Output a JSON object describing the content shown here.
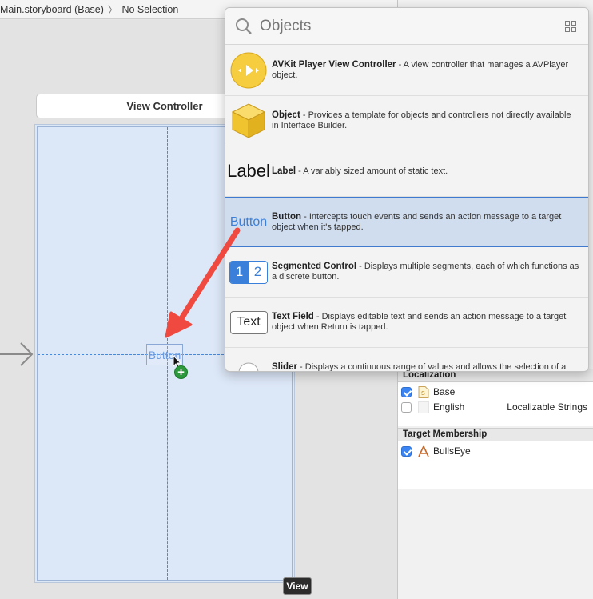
{
  "breadcrumb": {
    "file": "Main.storyboard (Base)",
    "selection": "No Selection"
  },
  "canvas": {
    "scene_title": "View Controller",
    "dragged_element_label": "Button",
    "tooltip": "View"
  },
  "library": {
    "search_placeholder": "Objects",
    "items": [
      {
        "title": "AVKit Player View Controller",
        "desc": " - A view controller that manages a AVPlayer object.",
        "icon": "avkit-player-icon"
      },
      {
        "title": "Object",
        "desc": " - Provides a template for objects and controllers not directly available in Interface Builder.",
        "icon": "object-cube-icon"
      },
      {
        "title": "Label",
        "desc": " - A variably sized amount of static text.",
        "icon": "label-icon",
        "icon_text": "Label"
      },
      {
        "title": "Button",
        "desc": " - Intercepts touch events and sends an action message to a target object when it's tapped.",
        "icon": "button-icon",
        "icon_text": "Button",
        "selected": true
      },
      {
        "title": "Segmented Control",
        "desc": " - Displays multiple segments, each of which functions as a discrete button.",
        "icon": "segmented-control-icon",
        "seg_labels": [
          "1",
          "2"
        ]
      },
      {
        "title": "Text Field",
        "desc": " - Displays editable text and sends an action message to a target object when Return is tapped.",
        "icon": "text-field-icon",
        "icon_text": "Text"
      },
      {
        "title": "Slider",
        "desc": " - Displays a continuous range of values and allows the selection of a single value.",
        "icon": "slider-icon"
      }
    ]
  },
  "inspector": {
    "localization_header": "Localization",
    "localization": [
      {
        "label": "Base",
        "checked": true,
        "value": ""
      },
      {
        "label": "English",
        "checked": false,
        "value": "Localizable Strings"
      }
    ],
    "target_header": "Target Membership",
    "targets": [
      {
        "label": "BullsEye",
        "checked": true
      }
    ]
  },
  "colors": {
    "accent": "#3a7fd9",
    "annotation_arrow": "#f0493f",
    "selection_bg": "#d0ddef"
  }
}
